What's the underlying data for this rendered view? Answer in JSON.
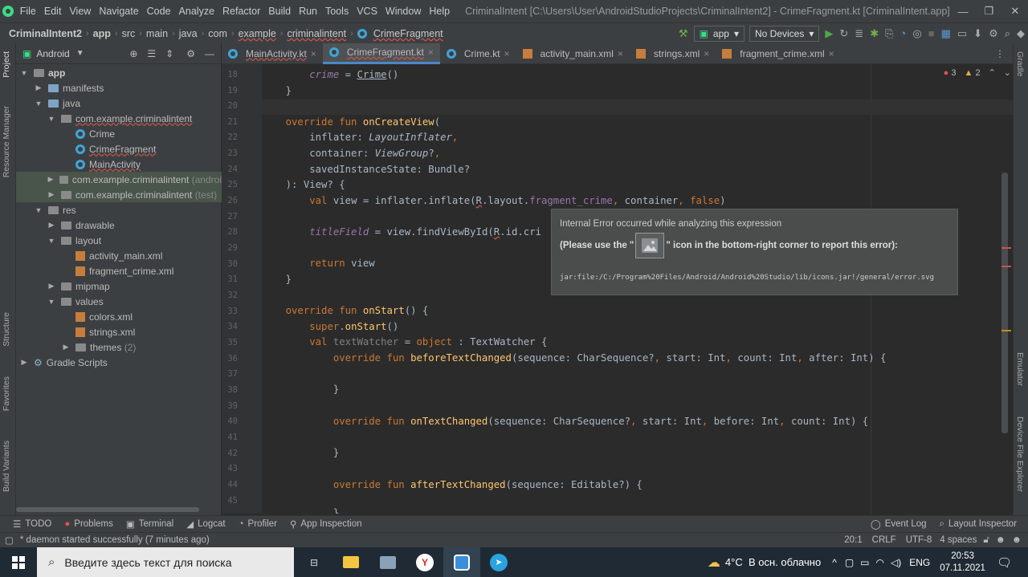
{
  "menu": {
    "items": [
      "File",
      "Edit",
      "View",
      "Navigate",
      "Code",
      "Analyze",
      "Refactor",
      "Build",
      "Run",
      "Tools",
      "VCS",
      "Window",
      "Help"
    ],
    "title": "CriminalIntent [C:\\Users\\User\\AndroidStudioProjects\\CriminalIntent2] - CrimeFragment.kt [CriminalIntent.app]"
  },
  "breadcrumb": {
    "project": "CriminalIntent2",
    "items": [
      "app",
      "src",
      "main",
      "java",
      "com",
      "example",
      "criminalintent",
      "CrimeFragment"
    ]
  },
  "toolbar": {
    "config": "app",
    "device": "No Devices"
  },
  "project_panel": {
    "view_mode": "Android"
  },
  "tree": [
    {
      "label": "app",
      "muted": ""
    },
    {
      "label": "manifests",
      "muted": ""
    },
    {
      "label": "java",
      "muted": ""
    },
    {
      "label": "com.example.criminalintent",
      "muted": ""
    },
    {
      "label": "Crime",
      "muted": ""
    },
    {
      "label": "CrimeFragment",
      "muted": ""
    },
    {
      "label": "MainActivity",
      "muted": ""
    },
    {
      "label": "com.example.criminalintent",
      "muted": "(androi"
    },
    {
      "label": "com.example.criminalintent",
      "muted": "(test)"
    },
    {
      "label": "res",
      "muted": ""
    },
    {
      "label": "drawable",
      "muted": ""
    },
    {
      "label": "layout",
      "muted": ""
    },
    {
      "label": "activity_main.xml",
      "muted": ""
    },
    {
      "label": "fragment_crime.xml",
      "muted": ""
    },
    {
      "label": "mipmap",
      "muted": ""
    },
    {
      "label": "values",
      "muted": ""
    },
    {
      "label": "colors.xml",
      "muted": ""
    },
    {
      "label": "strings.xml",
      "muted": ""
    },
    {
      "label": "themes",
      "muted": "(2)"
    },
    {
      "label": "Gradle Scripts",
      "muted": ""
    }
  ],
  "tabs": [
    "MainActivity.kt",
    "CrimeFragment.kt",
    "Crime.kt",
    "activity_main.xml",
    "strings.xml",
    "fragment_crime.xml"
  ],
  "inspection": {
    "errors": "3",
    "warnings": "2"
  },
  "line_numbers": [
    "18",
    "19",
    "20",
    "21",
    "22",
    "23",
    "24",
    "25",
    "26",
    "27",
    "28",
    "29",
    "30",
    "31",
    "32",
    "33",
    "34",
    "35",
    "36",
    "37",
    "38",
    "39",
    "40",
    "41",
    "42",
    "43",
    "44",
    "45"
  ],
  "popup": {
    "line1": "Internal Error occurred while analyzing this expression",
    "line2a": "(Please use the \"",
    "line2b": "\" icon in the bottom-right corner to report this error):",
    "path": "jar:file:/C:/Program%20Files/Android/Android%20Studio/lib/icons.jar!/general/error.svg"
  },
  "side_tabs": {
    "left": [
      "Project",
      "Resource Manager",
      "Structure",
      "Favorites",
      "Build Variants"
    ],
    "right": [
      "Gradle",
      "Emulator",
      "Device File Explorer"
    ]
  },
  "bottom_tools": [
    "TODO",
    "Problems",
    "Terminal",
    "Logcat",
    "Profiler",
    "App Inspection"
  ],
  "bottom_right_tools": [
    "Event Log",
    "Layout Inspector"
  ],
  "status": {
    "message": "* daemon started successfully (7 minutes ago)",
    "position": "20:1",
    "line_sep": "CRLF",
    "encoding": "UTF-8",
    "indent": "4 spaces"
  },
  "taskbar": {
    "search_placeholder": "Введите здесь текст для поиска",
    "weather": "4°C  В осн. облачно",
    "lang": "ENG",
    "time": "20:53",
    "date": "07.11.2021"
  }
}
